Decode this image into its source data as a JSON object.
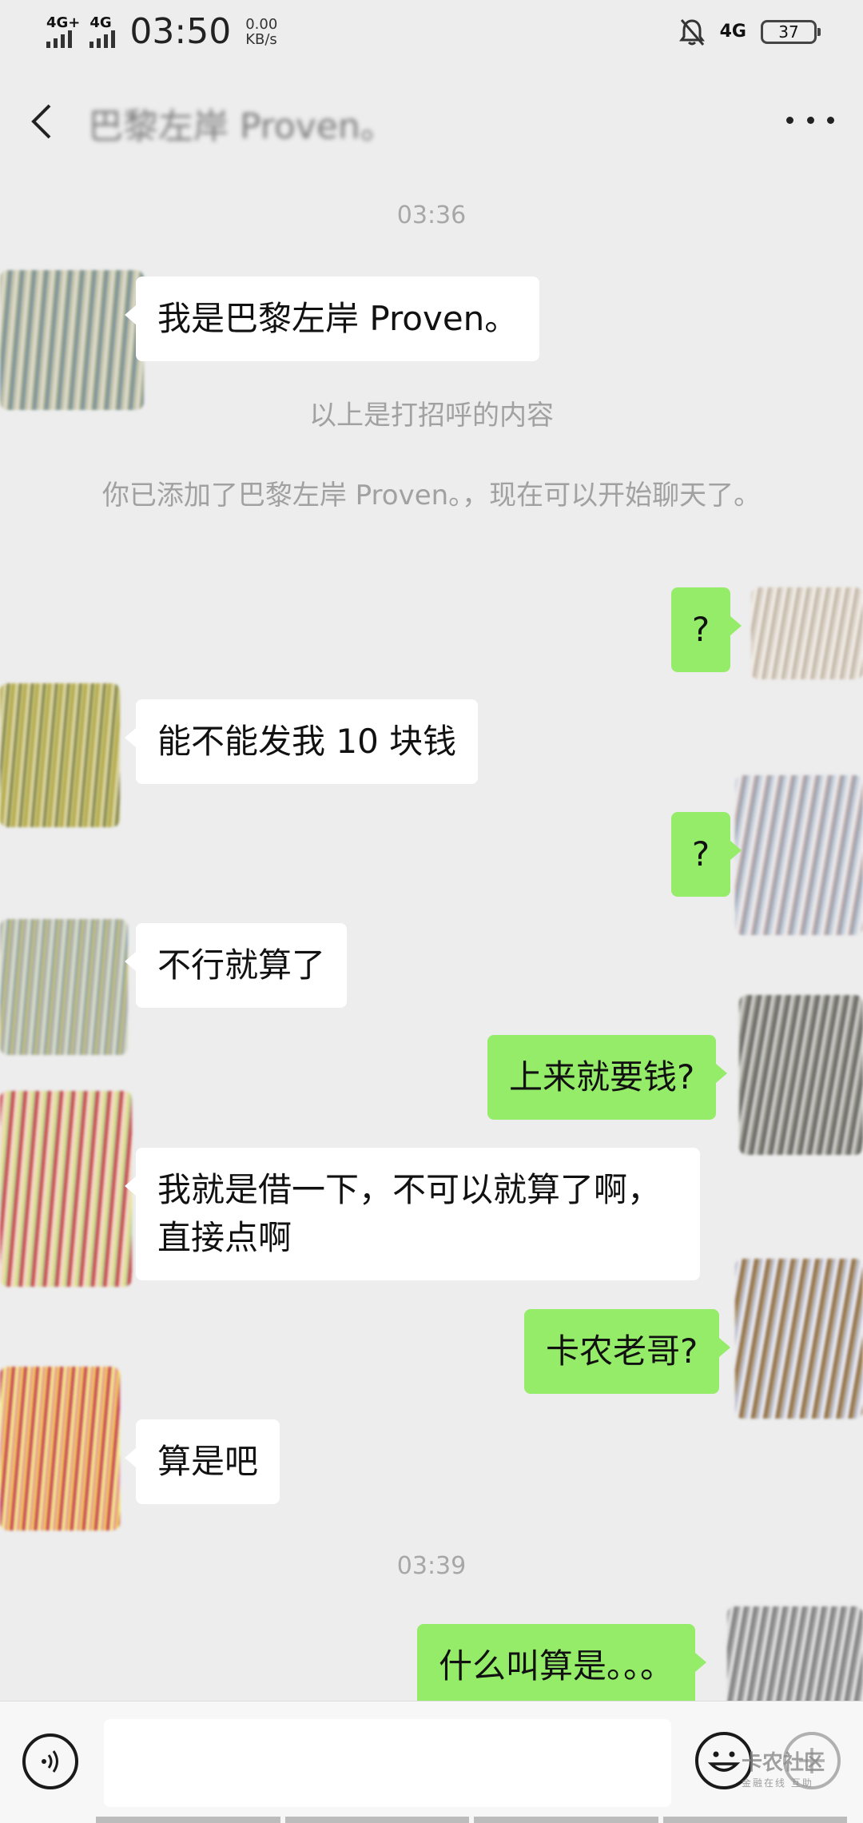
{
  "status_bar": {
    "network1": "4G+",
    "network2": "4G",
    "time": "03:50",
    "speed_value": "0.00",
    "speed_unit": "KB/s",
    "network_right": "4G",
    "battery": "37",
    "icons": [
      "signal-icon",
      "silent-bell-icon",
      "battery-icon"
    ]
  },
  "header": {
    "title": "巴黎左岸 Proven。",
    "back_icon": "chevron-left-icon",
    "more_icon": "more-dots-icon"
  },
  "chat": {
    "timestamp1": "03:36",
    "greeting_msg": "我是巴黎左岸  Proven。",
    "system_notice1": "以上是打招呼的内容",
    "system_notice2": "你已添加了巴黎左岸  Proven。，现在可以开始聊天了。",
    "msg_me_1": "?",
    "msg_them_2": "能不能发我 10 块钱",
    "msg_me_3": "?",
    "msg_them_4": "不行就算了",
    "msg_me_5": "上来就要钱?",
    "msg_them_6": "我就是借一下，不可以就算了啊，直接点啊",
    "msg_me_7": "卡农老哥?",
    "msg_them_8": "算是吧",
    "timestamp2": "03:39",
    "msg_me_9": "什么叫算是。。。"
  },
  "input_bar": {
    "input_value": "",
    "watermark_main": "卡农社区",
    "watermark_sub": "金融在线 互助"
  },
  "colors": {
    "background": "#ededed",
    "my_bubble": "#95ec69",
    "their_bubble": "#ffffff"
  }
}
